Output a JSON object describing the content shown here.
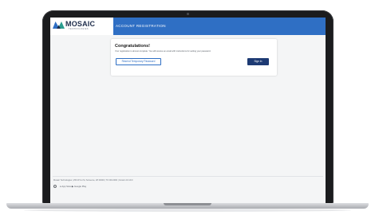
{
  "brand": {
    "name": "MOSAIC",
    "tagline": "TECHNOLOGIES",
    "colors": {
      "primary": "#2f6fc4",
      "dark": "#1c2b4a",
      "button_dark": "#1d3a73"
    }
  },
  "header": {
    "title": "ACCOUNT REGISTRATION"
  },
  "card": {
    "title": "Congratulations!",
    "message": "Your registration is almost complete. You will receive an email with instructions for setting your password.",
    "resend_label": "Resend Temporary Password",
    "signin_label": "Sign In"
  },
  "footer": {
    "info": "Mosaic Technologies  |  250 W 1st St, Someone, WI 00000  |  TF 000-0000  |  Version 16.19.0",
    "links": {
      "globe": "globe-icon",
      "app_store": "App Store",
      "google_play": "Google Play"
    }
  }
}
